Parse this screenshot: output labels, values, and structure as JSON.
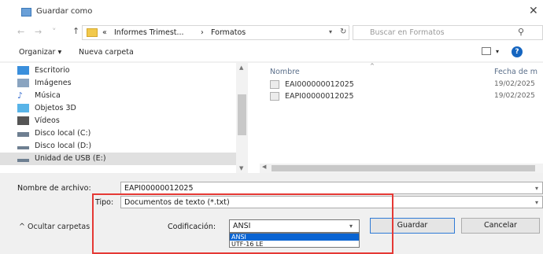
{
  "window": {
    "title": "Guardar como"
  },
  "nav": {
    "path": [
      "«",
      "Informes Trimest...",
      "›",
      "Formatos"
    ],
    "search_placeholder": "Buscar en Formatos"
  },
  "toolbar": {
    "organize": "Organizar ▾",
    "new_folder": "Nueva carpeta"
  },
  "sidebar": {
    "items": [
      {
        "label": "Escritorio",
        "icon": "desktop-icon",
        "color": "#3a8fdc"
      },
      {
        "label": "Imágenes",
        "icon": "pictures-icon",
        "color": "#8aa4c0"
      },
      {
        "label": "Música",
        "icon": "music-icon",
        "color": "#3a6fd0"
      },
      {
        "label": "Objetos 3D",
        "icon": "objects-3d-icon",
        "color": "#58b4e8"
      },
      {
        "label": "Vídeos",
        "icon": "videos-icon",
        "color": "#555555"
      },
      {
        "label": "Disco local (C:)",
        "icon": "drive-c-icon",
        "color": "#6e7f91"
      },
      {
        "label": "Disco local (D:)",
        "icon": "drive-d-icon",
        "color": "#6e7f91"
      },
      {
        "label": "Unidad de USB (E:)",
        "icon": "usb-drive-icon",
        "color": "#6e7f91",
        "selected": true
      }
    ]
  },
  "files": {
    "columns": [
      "Nombre",
      "Fecha de m"
    ],
    "rows": [
      {
        "name": "EAI000000012025",
        "date": "19/02/2025"
      },
      {
        "name": "EAPI00000012025",
        "date": "19/02/2025"
      }
    ]
  },
  "form": {
    "filename_label": "Nombre de archivo:",
    "filename_value": "EAPI00000012025",
    "type_label": "Tipo:",
    "type_value": "Documentos de texto (*.txt)"
  },
  "footer": {
    "hide_folders": "Ocultar carpetas",
    "encoding_label": "Codificación:",
    "encoding_value": "ANSI",
    "encoding_options": [
      "ANSI",
      "UTF-16 LE"
    ],
    "save": "Guardar",
    "cancel": "Cancelar"
  },
  "colors": {
    "accent": "#0a64d2",
    "highlight": "#e53935"
  }
}
